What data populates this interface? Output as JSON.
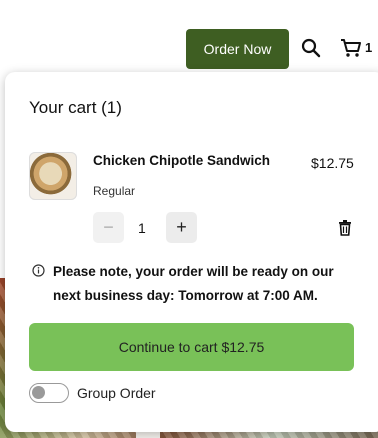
{
  "header": {
    "order_now_label": "Order Now",
    "cart_count": "1"
  },
  "cart": {
    "title": "Your cart (1)",
    "item": {
      "name": "Chicken Chipotle Sandwich",
      "price": "$12.75",
      "variant": "Regular",
      "quantity": "1",
      "minus_symbol": "−",
      "plus_symbol": "+"
    },
    "notice": "Please note, your order will be ready on our next business day: Tomorrow at 7:00 AM.",
    "continue_label": "Continue to cart $12.75",
    "group_order_label": "Group Order",
    "group_order_enabled": false
  },
  "icons": [
    "search-icon",
    "cart-icon",
    "trash-icon",
    "info-icon"
  ],
  "colors": {
    "order_now_bg": "#3e5e22",
    "continue_bg": "#79c158"
  }
}
